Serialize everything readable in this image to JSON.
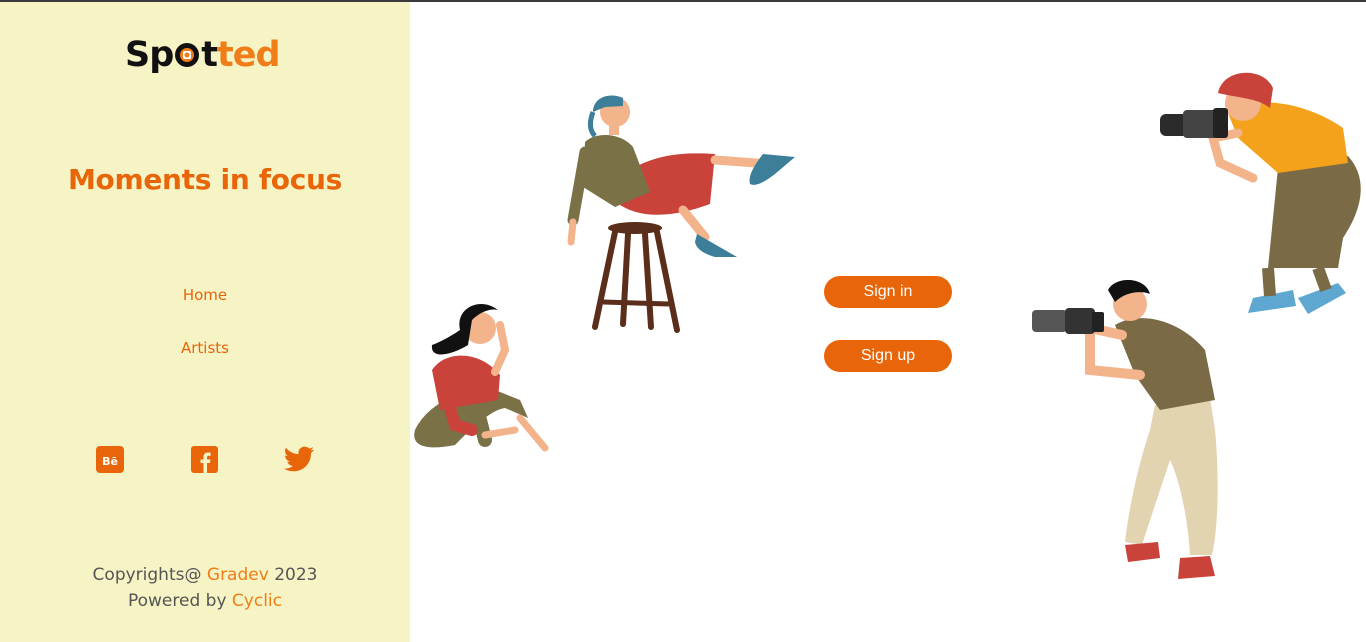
{
  "brand": {
    "logo_part1": "Sp",
    "logo_part2": "t",
    "logo_part3": "ted",
    "colors": {
      "accent": "#e8650a",
      "sidebar_bg": "#f6f3c4",
      "dark": "#111111"
    }
  },
  "sidebar": {
    "tagline": "Moments in focus",
    "nav": [
      {
        "label": "Home"
      },
      {
        "label": "Artists"
      }
    ],
    "socials": [
      {
        "icon": "behance-icon"
      },
      {
        "icon": "facebook-icon"
      },
      {
        "icon": "twitter-icon"
      }
    ],
    "footer": {
      "copyright_prefix": "Copyrights@",
      "copyright_name": "Gradev",
      "copyright_year": "2023",
      "powered_prefix": "Powered by",
      "powered_name": "Cyclic"
    }
  },
  "auth": {
    "signin_label": "Sign in",
    "signup_label": "Sign up"
  },
  "illustrations": [
    "woman-on-stool-illustration",
    "sitting-woman-illustration",
    "photographer-woman-illustration",
    "photographer-man-illustration"
  ]
}
